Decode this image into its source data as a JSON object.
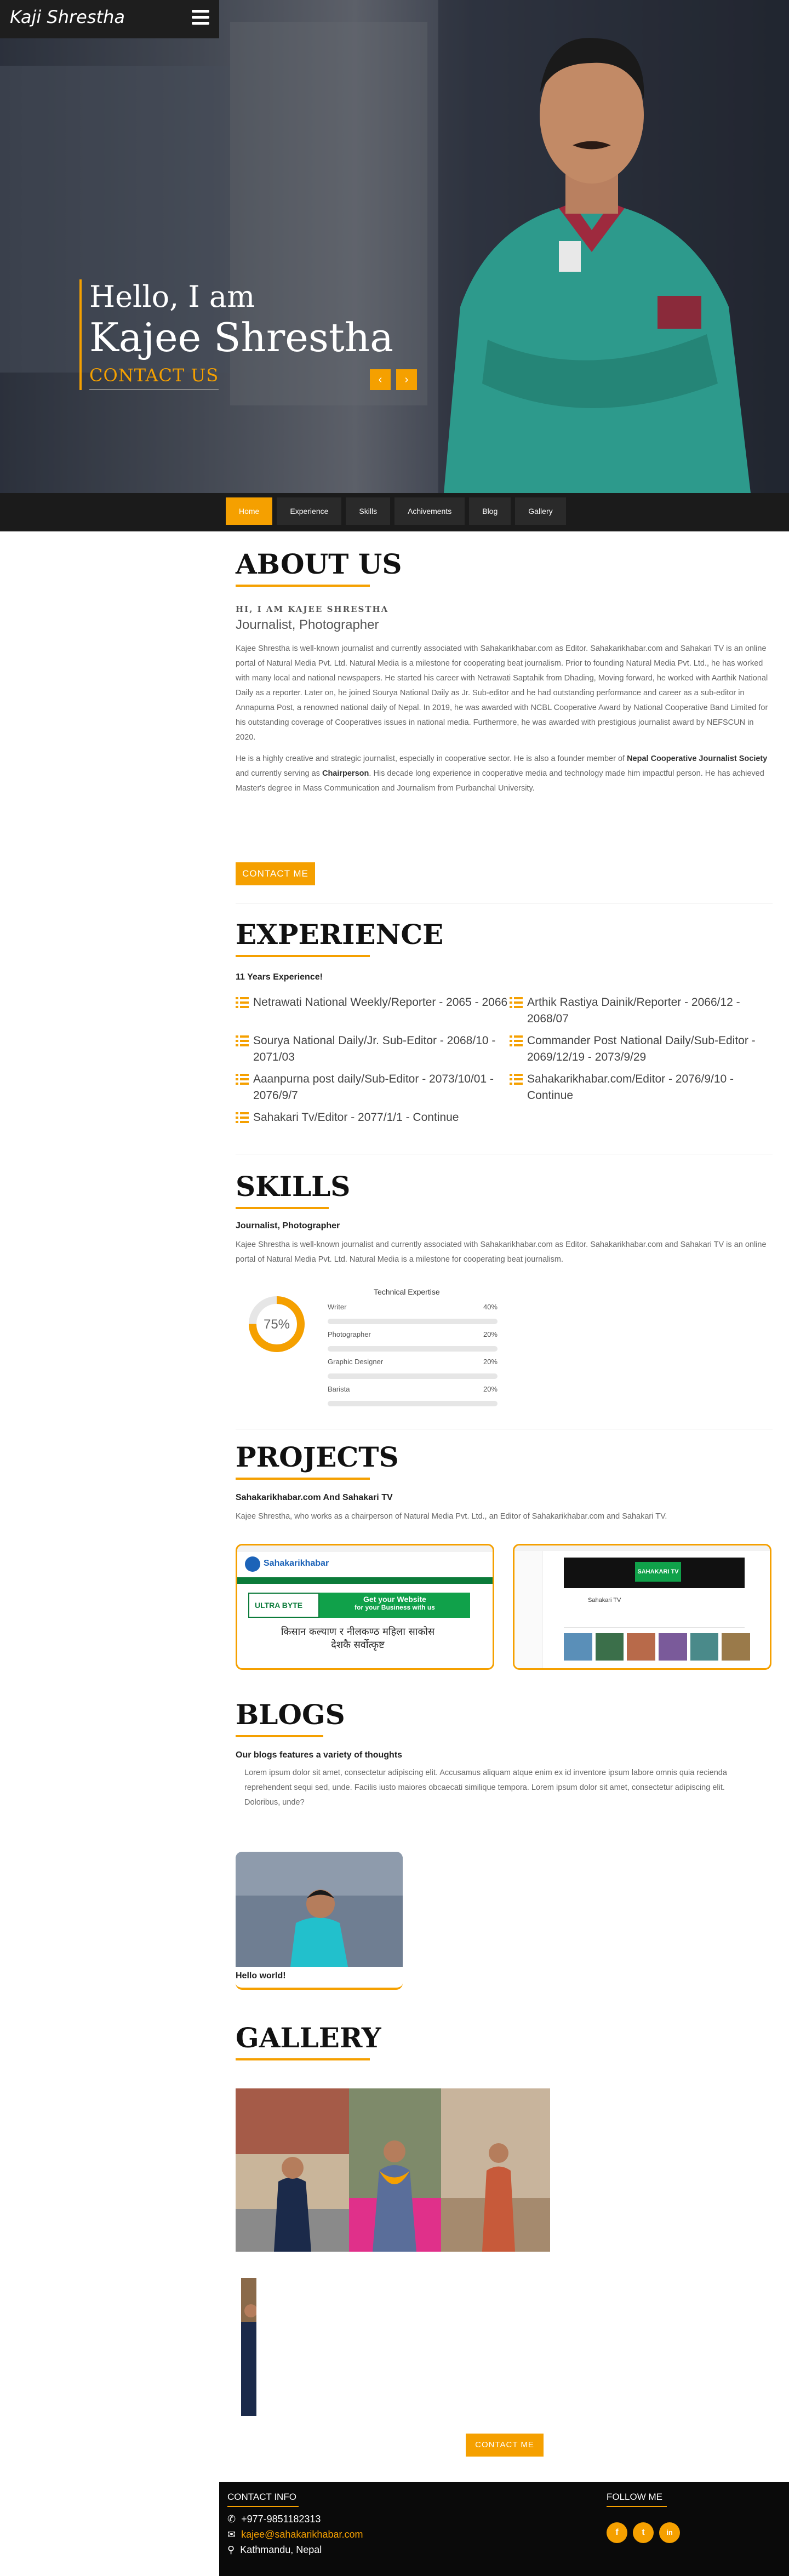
{
  "brand": "Kaji Shrestha",
  "hero": {
    "greeting": "Hello, I am",
    "name": "Kajee Shrestha",
    "contact": "CONTACT US"
  },
  "nav": [
    "Home",
    "Experience",
    "Skills",
    "Achivements",
    "Blog",
    "Gallery"
  ],
  "about": {
    "title": "ABOUT US",
    "kicker": "HI, I AM KAJEE SHRESTHA",
    "role": "Journalist, Photographer",
    "p1": "Kajee Shrestha is well-known journalist and currently associated with Sahakarikhabar.com as Editor. Sahakarikhabar.com and Sahakari TV is an online portal of Natural Media Pvt. Ltd. Natural Media is a milestone for cooperating beat journalism. Prior to founding Natural Media Pvt. Ltd., he has worked with many local and national newspapers. He started his career with Netrawati Saptahik from Dhading, Moving forward, he worked with Aarthik National Daily as a reporter. Later on, he joined Sourya National Daily as Jr. Sub-editor and he had outstanding performance and career as a sub-editor in Annapurna Post, a renowned national daily of Nepal. In 2019, he was awarded with NCBL Cooperative Award by National Cooperative Band Limited for his outstanding coverage of Cooperatives issues in national media. Furthermore, he was awarded with prestigious journalist award by NEFSCUN in 2020.",
    "p2_a": "He is a highly creative and strategic journalist, especially in cooperative sector. He is also a founder member of ",
    "p2_b": "Nepal Cooperative Journalist Society",
    "p2_c": " and currently serving as ",
    "p2_d": "Chairperson",
    "p2_e": ". His decade long experience in cooperative media and technology made him impactful person. He has achieved Master's degree in Mass Communication and Journalism from Purbanchal University.",
    "button": "CONTACT ME"
  },
  "experience": {
    "title": "EXPERIENCE",
    "years": "11 Years Experience!",
    "items": [
      "Netrawati National Weekly/Reporter - 2065 - 2066",
      "Arthik Rastiya Dainik/Reporter - 2066/12 - 2068/07",
      "Sourya National Daily/Jr. Sub-Editor - 2068/10 - 2071/03",
      "Commander Post National Daily/Sub-Editor - 2069/12/19 - 2073/9/29",
      "Aaanpurna post daily/Sub-Editor - 2073/10/01 - 2076/9/7",
      "Sahakarikhabar.com/Editor - 2076/9/10 - Continue",
      "Sahakari Tv/Editor - 2077/1/1 - Continue"
    ]
  },
  "skills": {
    "title": "SKILLS",
    "role": "Journalist, Photographer",
    "text": "Kajee Shrestha is well-known journalist and currently associated with Sahakarikhabar.com as Editor. Sahakarikhabar.com and Sahakari TV is an online portal of Natural Media Pvt. Ltd. Natural Media is a milestone for cooperating beat journalism.",
    "ring_value": "75%",
    "ring_fraction": 0.75,
    "tech_title": "Technical Expertise",
    "bars": [
      {
        "name": "Writer",
        "pct": "40%",
        "value": 0.4
      },
      {
        "name": "Photographer",
        "pct": "20%",
        "value": 0.2
      },
      {
        "name": "Graphic Designer",
        "pct": "20%",
        "value": 0.2
      },
      {
        "name": "Barista",
        "pct": "20%",
        "value": 0.2
      }
    ]
  },
  "projects": {
    "title": "PROJECTS",
    "subtitle": "Sahakarikhabar.com And Sahakari TV",
    "text": "Kajee Shrestha, who works as a chairperson of Natural Media Pvt. Ltd., an Editor of Sahakarikhabar.com and Sahakari TV.",
    "site1": {
      "logo": "Sahakarikhabar",
      "ad_brand": "ULTRA BYTE",
      "ad_line1": "Get your Website",
      "ad_line2": "for your Business with us",
      "headline1": "किसान कल्याण र नीलकण्ठ महिला साकोस",
      "headline2": "देशकै सर्वोत्कृष्ट"
    },
    "site2": {
      "logo": "SAHAKARI TV",
      "channel": "Sahakari TV"
    }
  },
  "blogs": {
    "title": "BLOGS",
    "subtitle": "Our blogs features a variety of thoughts",
    "text": "Lorem ipsum dolor sit amet, consectetur adipiscing elit. Accusamus aliquam atque enim ex id inventore ipsum labore omnis quia recienda reprehendent sequi sed, unde. Facilis iusto maiores obcaecati similique tempora. Lorem ipsum dolor sit amet, consectetur adipiscing elit. Doloribus, unde?",
    "post_title": "Hello world!"
  },
  "gallery": {
    "title": "GALLERY",
    "button": "CONTACT ME"
  },
  "footer": {
    "contact_title": "CONTACT INFO",
    "phone": "+977-9851182313",
    "email": "kajee@sahakarikhabar.com",
    "address": "Kathmandu, Nepal",
    "follow_title": "FOLLOW ME",
    "social": [
      "f",
      "t",
      "in"
    ]
  },
  "colors": {
    "accent": "#f5a000",
    "dark": "#1b1b1b"
  }
}
